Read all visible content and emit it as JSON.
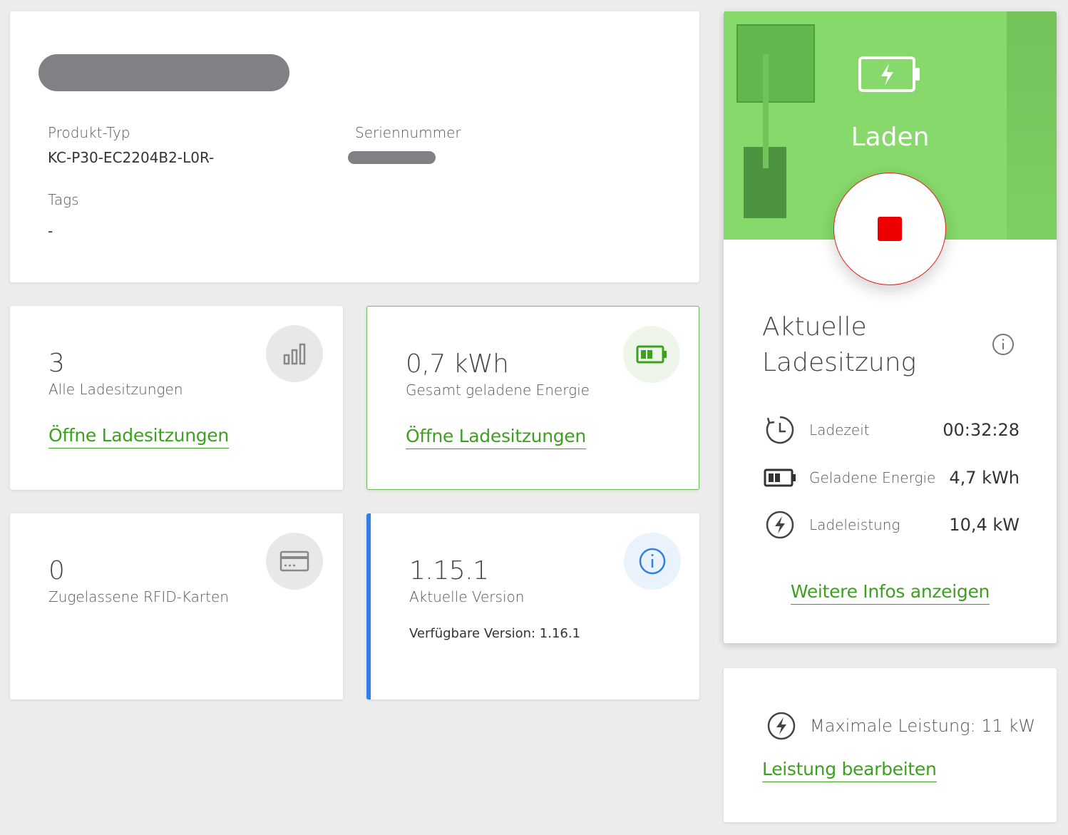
{
  "device": {
    "product_type_label": "Produkt-Typ",
    "product_type_value": "KC-P30-EC2204B2-L0R-",
    "serial_label": "Seriennummer",
    "tags_label": "Tags",
    "tags_value": "-"
  },
  "sessions_card": {
    "value": "3",
    "label": "Alle Ladesitzungen",
    "link": "Öffne Ladesitzungen",
    "icon": "bar-chart-icon"
  },
  "energy_card": {
    "value": "0,7 kWh",
    "label": "Gesamt geladene Energie",
    "link": "Öffne Ladesitzungen",
    "icon": "battery-icon"
  },
  "rfid_card": {
    "value": "0",
    "label": "Zugelassene RFID-Karten",
    "icon": "credit-card-icon"
  },
  "version_card": {
    "value": "1.15.1",
    "label": "Aktuelle Version",
    "available": "Verfügbare Version: 1.16.1",
    "icon": "info-icon"
  },
  "charging_panel": {
    "status": "Laden",
    "title_line1": "Aktuelle",
    "title_line2": "Ladesitzung",
    "rows": [
      {
        "label": "Ladezeit",
        "value": "00:32:28",
        "icon": "clock-icon"
      },
      {
        "label": "Geladene Energie",
        "value": "4,7 kWh",
        "icon": "battery-icon"
      },
      {
        "label": "Ladeleistung",
        "value": "10,4 kW",
        "icon": "lightning-icon"
      }
    ],
    "link": "Weitere Infos anzeigen"
  },
  "power_card": {
    "text": "Maximale Leistung: 11 kW",
    "link": "Leistung bearbeiten",
    "icon": "lightning-icon"
  },
  "colors": {
    "brand_green": "#3da021",
    "stop_red": "#ee0000",
    "info_blue": "#2f7fe6"
  }
}
